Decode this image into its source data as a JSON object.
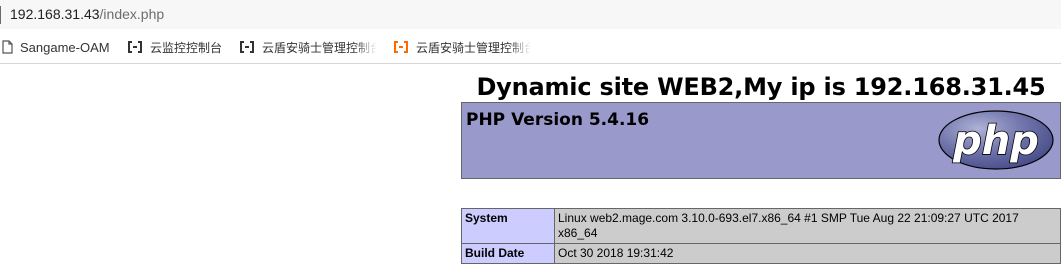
{
  "browser": {
    "url_host": "192.168.31.43",
    "url_path": "/index.php",
    "bookmarks": [
      {
        "label": "Sangame-OAM",
        "icon": "page-icon"
      },
      {
        "label": "云监控控制台",
        "icon": "aliyun-icon",
        "color": "#333333"
      },
      {
        "label": "云盾安骑士管理控制台",
        "icon": "aliyun-icon",
        "color": "#333333"
      },
      {
        "label": "云盾安骑士管理控制台",
        "icon": "aliyun-icon",
        "color": "#ff6a00"
      }
    ]
  },
  "page": {
    "heading": "Dynamic site WEB2,My ip is 192.168.31.45",
    "php_version": "PHP Version 5.4.16",
    "logo_text": "php",
    "colors": {
      "header_bg": "#9999cc",
      "label_bg": "#ccccff",
      "value_bg": "#cccccc"
    },
    "rows": [
      {
        "label": "System",
        "value": "Linux web2.mage.com 3.10.0-693.el7.x86_64 #1 SMP Tue Aug 22 21:09:27 UTC 2017 x86_64"
      },
      {
        "label": "Build Date",
        "value": "Oct 30 2018 19:31:42"
      }
    ]
  }
}
